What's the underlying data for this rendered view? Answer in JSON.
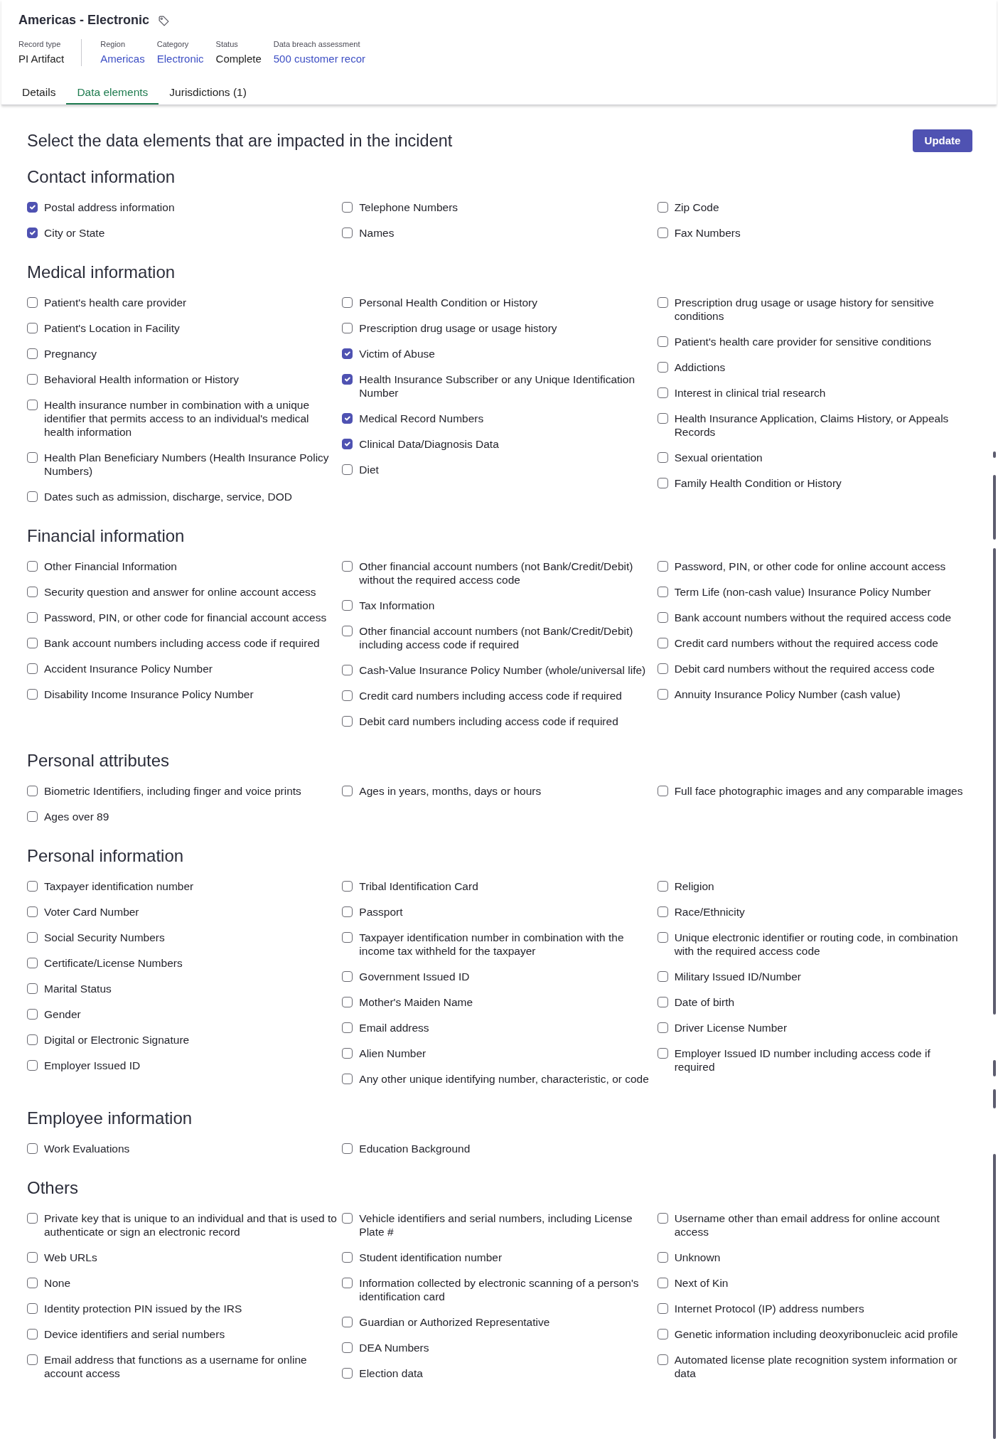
{
  "record": {
    "title": "Americas - Electronic",
    "record_type": {
      "label": "Record type",
      "value": "PI Artifact"
    },
    "fields": [
      {
        "label": "Region",
        "value": "Americas",
        "kind": "link"
      },
      {
        "label": "Category",
        "value": "Electronic",
        "kind": "link"
      },
      {
        "label": "Status",
        "value": "Complete",
        "kind": "text"
      },
      {
        "label": "Data breach assessment",
        "value": "500 customer recor",
        "kind": "link"
      }
    ]
  },
  "tabs": [
    {
      "label": "Details",
      "selected": false
    },
    {
      "label": "Data elements",
      "selected": true
    },
    {
      "label": "Jurisdictions (1)",
      "selected": false
    }
  ],
  "prompt": "Select the data elements that are impacted in the incident",
  "update_button": {
    "label": "Update"
  },
  "sections": [
    {
      "title": "Contact information",
      "columns": [
        [
          {
            "label": "Postal address information",
            "checked": true
          },
          {
            "label": "City or State",
            "checked": true
          }
        ],
        [
          {
            "label": "Telephone Numbers",
            "checked": false
          },
          {
            "label": "Names",
            "checked": false
          }
        ],
        [
          {
            "label": "Zip Code",
            "checked": false
          },
          {
            "label": "Fax Numbers",
            "checked": false
          }
        ]
      ]
    },
    {
      "title": "Medical information",
      "columns": [
        [
          {
            "label": "Patient's health care provider",
            "checked": false
          },
          {
            "label": "Patient's Location in Facility",
            "checked": false
          },
          {
            "label": "Pregnancy",
            "checked": false
          },
          {
            "label": "Behavioral Health information or History",
            "checked": false
          },
          {
            "label": "Health insurance number in combination with a unique identifier that permits access to an individual's medical health information",
            "checked": false
          },
          {
            "label": "Health Plan Beneficiary Numbers (Health Insurance Policy Numbers)",
            "checked": false
          },
          {
            "label": "Dates such as admission, discharge, service, DOD",
            "checked": false
          }
        ],
        [
          {
            "label": "Personal Health Condition or History",
            "checked": false
          },
          {
            "label": "Prescription drug usage or usage history",
            "checked": false
          },
          {
            "label": "Victim of Abuse",
            "checked": true
          },
          {
            "label": "Health Insurance Subscriber or any Unique Identification Number",
            "checked": true
          },
          {
            "label": "Medical Record Numbers",
            "checked": true
          },
          {
            "label": "Clinical Data/Diagnosis Data",
            "checked": true
          },
          {
            "label": "Diet",
            "checked": false
          }
        ],
        [
          {
            "label": "Prescription drug usage or usage history for sensitive conditions",
            "checked": false
          },
          {
            "label": "Patient's health care provider for sensitive conditions",
            "checked": false
          },
          {
            "label": "Addictions",
            "checked": false
          },
          {
            "label": "Interest in clinical trial research",
            "checked": false
          },
          {
            "label": "Health Insurance Application, Claims History, or Appeals Records",
            "checked": false
          },
          {
            "label": "Sexual orientation",
            "checked": false
          },
          {
            "label": "Family Health Condition or History",
            "checked": false
          }
        ]
      ]
    },
    {
      "title": "Financial information",
      "columns": [
        [
          {
            "label": "Other Financial Information",
            "checked": false
          },
          {
            "label": "Security question and answer for online account access",
            "checked": false
          },
          {
            "label": "Password, PIN, or other code for financial account access",
            "checked": false
          },
          {
            "label": "Bank account numbers including access code if required",
            "checked": false
          },
          {
            "label": "Accident Insurance Policy Number",
            "checked": false
          },
          {
            "label": "Disability Income Insurance Policy Number",
            "checked": false
          }
        ],
        [
          {
            "label": "Other financial account numbers (not Bank/Credit/Debit) without the required access code",
            "checked": false
          },
          {
            "label": "Tax Information",
            "checked": false
          },
          {
            "label": "Other financial account numbers (not Bank/Credit/Debit) including access code if required",
            "checked": false
          },
          {
            "label": "Cash-Value Insurance Policy Number (whole/universal life)",
            "checked": false
          },
          {
            "label": "Credit card numbers including access code if required",
            "checked": false
          },
          {
            "label": "Debit card numbers including access code if required",
            "checked": false
          }
        ],
        [
          {
            "label": "Password, PIN, or other code for online account access",
            "checked": false
          },
          {
            "label": "Term Life (non-cash value) Insurance Policy Number",
            "checked": false
          },
          {
            "label": "Bank account numbers without the required access code",
            "checked": false
          },
          {
            "label": "Credit card numbers without the required access code",
            "checked": false
          },
          {
            "label": "Debit card numbers without the required access code",
            "checked": false
          },
          {
            "label": "Annuity Insurance Policy Number (cash value)",
            "checked": false
          }
        ]
      ]
    },
    {
      "title": "Personal attributes",
      "columns": [
        [
          {
            "label": "Biometric Identifiers, including finger and voice prints",
            "checked": false
          },
          {
            "label": "Ages over 89",
            "checked": false
          }
        ],
        [
          {
            "label": "Ages in years, months, days or hours",
            "checked": false
          }
        ],
        [
          {
            "label": "Full face photographic images and any comparable images",
            "checked": false
          }
        ]
      ]
    },
    {
      "title": "Personal information",
      "columns": [
        [
          {
            "label": "Taxpayer identification number",
            "checked": false
          },
          {
            "label": "Voter Card Number",
            "checked": false
          },
          {
            "label": "Social Security Numbers",
            "checked": false
          },
          {
            "label": "Certificate/License Numbers",
            "checked": false
          },
          {
            "label": "Marital Status",
            "checked": false
          },
          {
            "label": "Gender",
            "checked": false
          },
          {
            "label": "Digital or Electronic Signature",
            "checked": false
          },
          {
            "label": "Employer Issued ID",
            "checked": false
          }
        ],
        [
          {
            "label": "Tribal Identification Card",
            "checked": false
          },
          {
            "label": "Passport",
            "checked": false
          },
          {
            "label": "Taxpayer identification number in combination with the income tax withheld for the taxpayer",
            "checked": false
          },
          {
            "label": "Government Issued ID",
            "checked": false
          },
          {
            "label": "Mother's Maiden Name",
            "checked": false
          },
          {
            "label": "Email address",
            "checked": false
          },
          {
            "label": "Alien Number",
            "checked": false
          },
          {
            "label": "Any other unique identifying number, characteristic, or code",
            "checked": false
          }
        ],
        [
          {
            "label": "Religion",
            "checked": false
          },
          {
            "label": "Race/Ethnicity",
            "checked": false
          },
          {
            "label": "Unique electronic identifier or routing code, in combination with the required access code",
            "checked": false
          },
          {
            "label": "Military Issued ID/Number",
            "checked": false
          },
          {
            "label": "Date of birth",
            "checked": false
          },
          {
            "label": "Driver License Number",
            "checked": false
          },
          {
            "label": "Employer Issued ID number including access code if required",
            "checked": false
          }
        ]
      ]
    },
    {
      "title": "Employee information",
      "columns": [
        [
          {
            "label": "Work Evaluations",
            "checked": false
          }
        ],
        [
          {
            "label": "Education Background",
            "checked": false
          }
        ]
      ]
    },
    {
      "title": "Others",
      "columns": [
        [
          {
            "label": "Private key that is unique to an individual and that is used to authenticate or sign an electronic record",
            "checked": false
          },
          {
            "label": "Web URLs",
            "checked": false
          },
          {
            "label": "None",
            "checked": false
          },
          {
            "label": "Identity protection PIN issued by the IRS",
            "checked": false
          },
          {
            "label": "Device identifiers and serial numbers",
            "checked": false
          },
          {
            "label": "Email address that functions as a username for online account access",
            "checked": false
          }
        ],
        [
          {
            "label": "Vehicle identifiers and serial numbers, including License Plate #",
            "checked": false
          },
          {
            "label": "Student identification number",
            "checked": false
          },
          {
            "label": "Information collected by electronic scanning of a person's identification card",
            "checked": false
          },
          {
            "label": "Guardian or Authorized Representative",
            "checked": false
          },
          {
            "label": "DEA Numbers",
            "checked": false
          },
          {
            "label": "Election data",
            "checked": false
          }
        ],
        [
          {
            "label": "Username other than email address for online account access",
            "checked": false
          },
          {
            "label": "Unknown",
            "checked": false
          },
          {
            "label": "Next of Kin",
            "checked": false
          },
          {
            "label": "Internet Protocol (IP) address numbers",
            "checked": false
          },
          {
            "label": "Genetic information including deoxyribonucleic acid profile",
            "checked": false
          },
          {
            "label": "Automated license plate recognition system information or data",
            "checked": false
          }
        ]
      ]
    }
  ]
}
